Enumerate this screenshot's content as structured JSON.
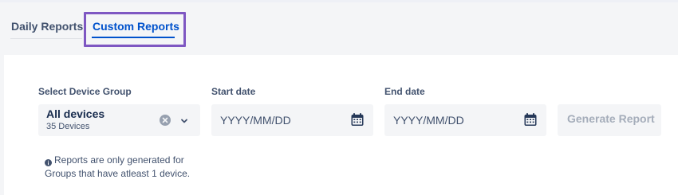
{
  "tabs": [
    {
      "label": "Daily Reports",
      "active": false
    },
    {
      "label": "Custom Reports",
      "active": true
    }
  ],
  "form": {
    "device_group": {
      "label": "Select Device Group",
      "value": "All devices",
      "sub": "35 Devices"
    },
    "start_date": {
      "label": "Start date",
      "placeholder": "YYYY/MM/DD"
    },
    "end_date": {
      "label": "End date",
      "placeholder": "YYYY/MM/DD"
    },
    "generate_button": "Generate Report",
    "info_note": "Reports are only generated for Groups that have atleast 1 device."
  },
  "icons": {
    "clear": "clear-icon",
    "chevron": "chevron-down-icon",
    "calendar": "calendar-icon",
    "info": "info-icon"
  },
  "colors": {
    "accent": "#0052cc",
    "highlight": "#7e57c2",
    "field_bg": "#f4f5f7",
    "disabled_text": "#a5adba"
  }
}
